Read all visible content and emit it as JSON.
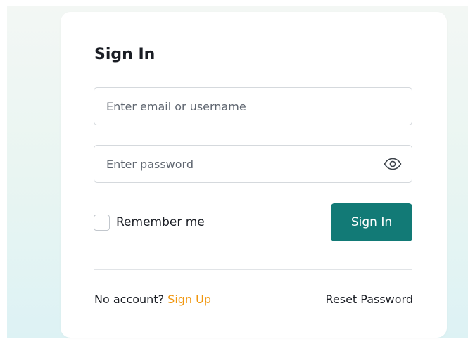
{
  "form": {
    "title": "Sign In",
    "email_placeholder": "Enter email or username",
    "email_value": "",
    "password_placeholder": "Enter password",
    "password_value": "",
    "password_toggle_icon": "eye-icon",
    "remember_label": "Remember me",
    "remember_checked": false,
    "submit_label": "Sign In"
  },
  "footer": {
    "no_account_text": "No account?",
    "signup_label": "Sign Up",
    "reset_label": "Reset Password"
  },
  "colors": {
    "primary": "#127a76",
    "link_accent": "#f0960e",
    "text": "#1a1d24",
    "placeholder": "#5f6670",
    "border": "#d5d9dd"
  }
}
